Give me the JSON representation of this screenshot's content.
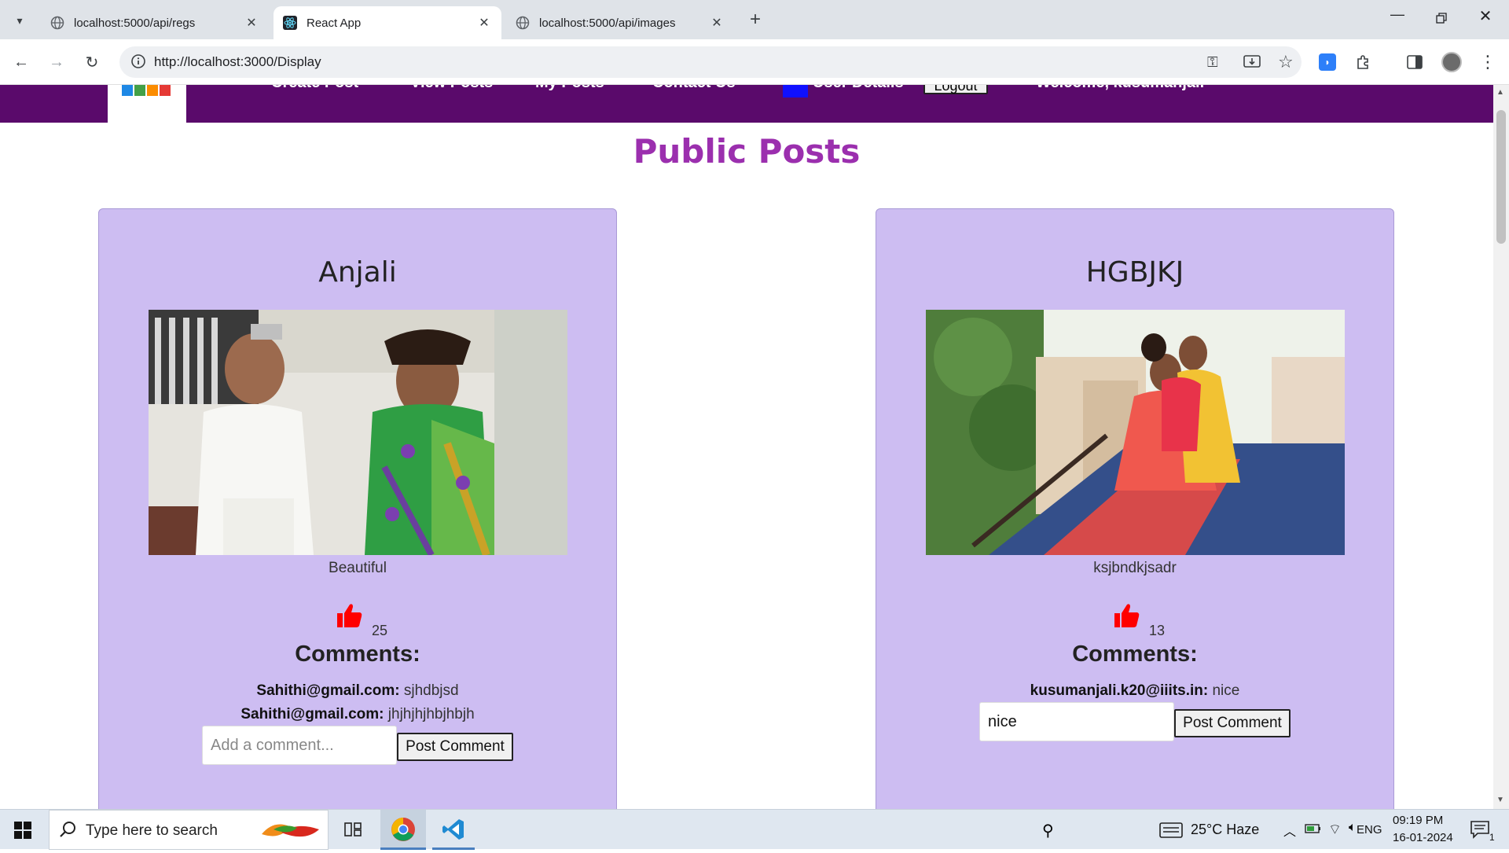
{
  "browser": {
    "tabs": [
      {
        "title": "localhost:5000/api/regs",
        "active": false
      },
      {
        "title": "React App",
        "active": true
      },
      {
        "title": "localhost:5000/api/images",
        "active": false
      }
    ],
    "url": "http://localhost:3000/Display"
  },
  "nav": {
    "items": [
      "Create Post",
      "View Posts",
      "My Posts",
      "Contact Us",
      "User Details"
    ],
    "logout": "Logout",
    "welcome": "Welcome, kusumanjali"
  },
  "page": {
    "title": "Public Posts"
  },
  "posts": [
    {
      "title": "Anjali",
      "caption": "Beautiful",
      "likes": "25",
      "comments_heading": "Comments:",
      "comments": [
        {
          "user": "Sahithi@gmail.com:",
          "text": "sjhdbjsd"
        },
        {
          "user": "Sahithi@gmail.com:",
          "text": "jhjhjhjhbjhbjh"
        }
      ],
      "input_value": "",
      "input_placeholder": "Add a comment...",
      "button": "Post Comment"
    },
    {
      "title": "HGBJKJ",
      "caption": "ksjbndkjsadr",
      "likes": "13",
      "comments_heading": "Comments:",
      "comments": [
        {
          "user": "kusumanjali.k20@iiits.in:",
          "text": "nice"
        }
      ],
      "input_value": "nice",
      "input_placeholder": "",
      "button": "Post Comment"
    }
  ],
  "taskbar": {
    "search_placeholder": "Type here to search",
    "weather": "25°C  Haze",
    "language": "ENG",
    "time": "09:19 PM",
    "date": "16-01-2024"
  },
  "colors": {
    "navbar": "#5a0a6b",
    "title": "#9b2fae",
    "card": "#cdbdf2",
    "like": "#ff0000"
  }
}
